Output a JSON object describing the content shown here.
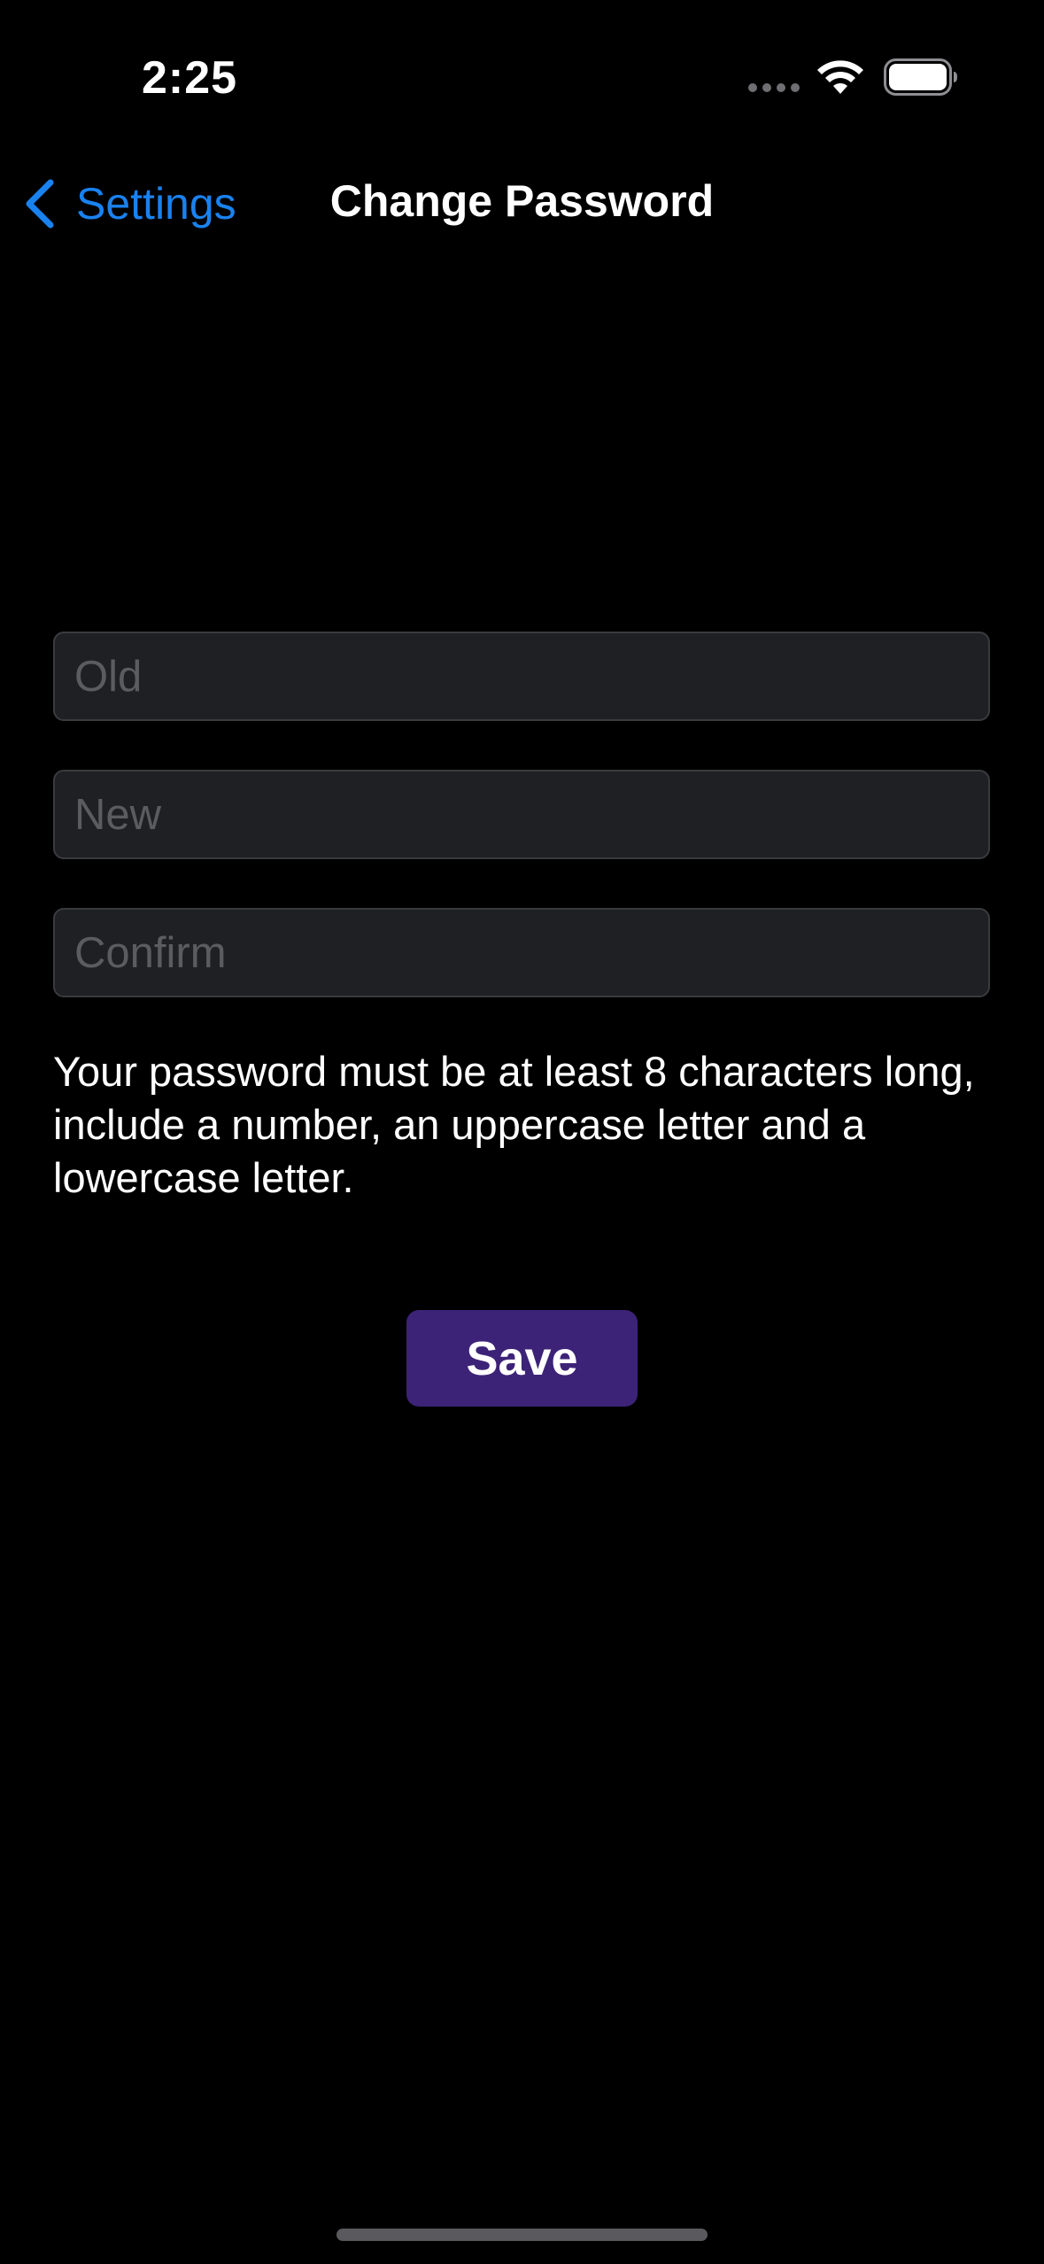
{
  "status_bar": {
    "time": "2:25",
    "icons": [
      "cellular-signal-icon",
      "wifi-icon",
      "battery-icon"
    ]
  },
  "nav": {
    "back_label": "Settings",
    "title": "Change Password",
    "back_icon": "chevron-left-icon"
  },
  "form": {
    "old_placeholder": "Old",
    "new_placeholder": "New",
    "confirm_placeholder": "Confirm",
    "old_value": "",
    "new_value": "",
    "confirm_value": "",
    "hint": "Your password must be at least 8 characters long, include a number, an uppercase letter and a lowercase letter.",
    "save_label": "Save"
  },
  "colors": {
    "background": "#000000",
    "accent": "#1a82f0",
    "field_background": "#1f2023",
    "field_border": "#3a3b3f",
    "placeholder": "#5b5c61",
    "save_button": "#3d2377",
    "text": "#ffffff"
  }
}
